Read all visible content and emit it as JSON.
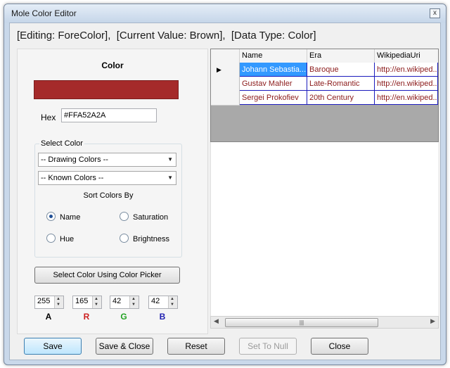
{
  "window": {
    "title": "Mole Color Editor",
    "close_glyph": "x"
  },
  "header": {
    "editing": "[Editing: ForeColor],",
    "current_value": "[Current Value: Brown],",
    "data_type": "[Data Type: Color]"
  },
  "color_panel": {
    "title": "Color",
    "swatch_color": "#A52A2A",
    "hex_label": "Hex",
    "hex_value": "#FFA52A2A"
  },
  "select_color": {
    "group_title": "Select Color",
    "drawing_colors": "-- Drawing Colors --",
    "known_colors": "-- Known Colors --",
    "sort_label": "Sort Colors By",
    "options": {
      "name": "Name",
      "saturation": "Saturation",
      "hue": "Hue",
      "brightness": "Brightness"
    },
    "selected": "Name"
  },
  "picker_button": "Select Color Using Color Picker",
  "argb": {
    "a": {
      "label": "A",
      "value": "255",
      "color": "#000000"
    },
    "r": {
      "label": "R",
      "value": "165",
      "color": "#cc1f1f"
    },
    "g": {
      "label": "G",
      "value": "42",
      "color": "#22a322"
    },
    "b": {
      "label": "B",
      "value": "42",
      "color": "#1f1fb0"
    }
  },
  "grid": {
    "columns": [
      "Name",
      "Era",
      "WikipediaUri"
    ],
    "rows": [
      [
        "Johann Sebastia...",
        "Baroque",
        "http://en.wikiped..."
      ],
      [
        "Gustav Mahler",
        "Late-Romantic",
        "http://en.wikiped..."
      ],
      [
        "Sergei Prokofiev",
        "20th Century",
        "http://en.wikiped..."
      ]
    ],
    "row_indicator": "▶"
  },
  "buttons": {
    "save": "Save",
    "save_close": "Save & Close",
    "reset": "Reset",
    "set_null": "Set To Null",
    "close": "Close"
  }
}
